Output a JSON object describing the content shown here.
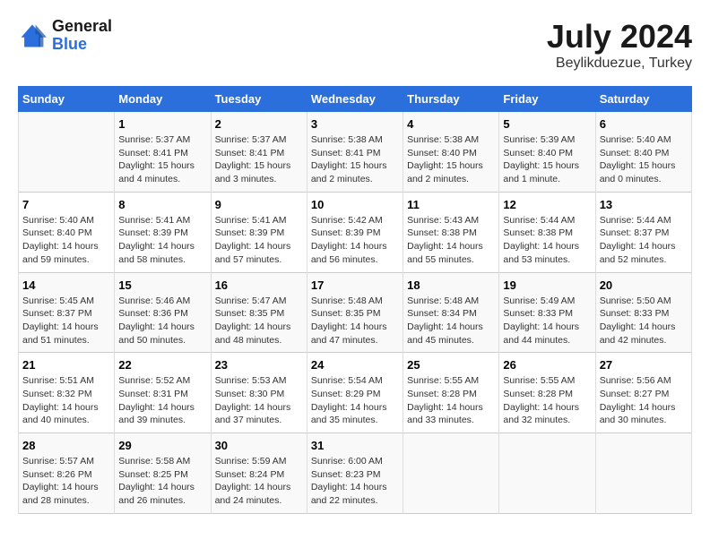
{
  "header": {
    "logo_general": "General",
    "logo_blue": "Blue",
    "month_year": "July 2024",
    "location": "Beylikduezue, Turkey"
  },
  "weekdays": [
    "Sunday",
    "Monday",
    "Tuesday",
    "Wednesday",
    "Thursday",
    "Friday",
    "Saturday"
  ],
  "weeks": [
    [
      {
        "day": "",
        "info": ""
      },
      {
        "day": "1",
        "info": "Sunrise: 5:37 AM\nSunset: 8:41 PM\nDaylight: 15 hours\nand 4 minutes."
      },
      {
        "day": "2",
        "info": "Sunrise: 5:37 AM\nSunset: 8:41 PM\nDaylight: 15 hours\nand 3 minutes."
      },
      {
        "day": "3",
        "info": "Sunrise: 5:38 AM\nSunset: 8:41 PM\nDaylight: 15 hours\nand 2 minutes."
      },
      {
        "day": "4",
        "info": "Sunrise: 5:38 AM\nSunset: 8:40 PM\nDaylight: 15 hours\nand 2 minutes."
      },
      {
        "day": "5",
        "info": "Sunrise: 5:39 AM\nSunset: 8:40 PM\nDaylight: 15 hours\nand 1 minute."
      },
      {
        "day": "6",
        "info": "Sunrise: 5:40 AM\nSunset: 8:40 PM\nDaylight: 15 hours\nand 0 minutes."
      }
    ],
    [
      {
        "day": "7",
        "info": "Sunrise: 5:40 AM\nSunset: 8:40 PM\nDaylight: 14 hours\nand 59 minutes."
      },
      {
        "day": "8",
        "info": "Sunrise: 5:41 AM\nSunset: 8:39 PM\nDaylight: 14 hours\nand 58 minutes."
      },
      {
        "day": "9",
        "info": "Sunrise: 5:41 AM\nSunset: 8:39 PM\nDaylight: 14 hours\nand 57 minutes."
      },
      {
        "day": "10",
        "info": "Sunrise: 5:42 AM\nSunset: 8:39 PM\nDaylight: 14 hours\nand 56 minutes."
      },
      {
        "day": "11",
        "info": "Sunrise: 5:43 AM\nSunset: 8:38 PM\nDaylight: 14 hours\nand 55 minutes."
      },
      {
        "day": "12",
        "info": "Sunrise: 5:44 AM\nSunset: 8:38 PM\nDaylight: 14 hours\nand 53 minutes."
      },
      {
        "day": "13",
        "info": "Sunrise: 5:44 AM\nSunset: 8:37 PM\nDaylight: 14 hours\nand 52 minutes."
      }
    ],
    [
      {
        "day": "14",
        "info": "Sunrise: 5:45 AM\nSunset: 8:37 PM\nDaylight: 14 hours\nand 51 minutes."
      },
      {
        "day": "15",
        "info": "Sunrise: 5:46 AM\nSunset: 8:36 PM\nDaylight: 14 hours\nand 50 minutes."
      },
      {
        "day": "16",
        "info": "Sunrise: 5:47 AM\nSunset: 8:35 PM\nDaylight: 14 hours\nand 48 minutes."
      },
      {
        "day": "17",
        "info": "Sunrise: 5:48 AM\nSunset: 8:35 PM\nDaylight: 14 hours\nand 47 minutes."
      },
      {
        "day": "18",
        "info": "Sunrise: 5:48 AM\nSunset: 8:34 PM\nDaylight: 14 hours\nand 45 minutes."
      },
      {
        "day": "19",
        "info": "Sunrise: 5:49 AM\nSunset: 8:33 PM\nDaylight: 14 hours\nand 44 minutes."
      },
      {
        "day": "20",
        "info": "Sunrise: 5:50 AM\nSunset: 8:33 PM\nDaylight: 14 hours\nand 42 minutes."
      }
    ],
    [
      {
        "day": "21",
        "info": "Sunrise: 5:51 AM\nSunset: 8:32 PM\nDaylight: 14 hours\nand 40 minutes."
      },
      {
        "day": "22",
        "info": "Sunrise: 5:52 AM\nSunset: 8:31 PM\nDaylight: 14 hours\nand 39 minutes."
      },
      {
        "day": "23",
        "info": "Sunrise: 5:53 AM\nSunset: 8:30 PM\nDaylight: 14 hours\nand 37 minutes."
      },
      {
        "day": "24",
        "info": "Sunrise: 5:54 AM\nSunset: 8:29 PM\nDaylight: 14 hours\nand 35 minutes."
      },
      {
        "day": "25",
        "info": "Sunrise: 5:55 AM\nSunset: 8:28 PM\nDaylight: 14 hours\nand 33 minutes."
      },
      {
        "day": "26",
        "info": "Sunrise: 5:55 AM\nSunset: 8:28 PM\nDaylight: 14 hours\nand 32 minutes."
      },
      {
        "day": "27",
        "info": "Sunrise: 5:56 AM\nSunset: 8:27 PM\nDaylight: 14 hours\nand 30 minutes."
      }
    ],
    [
      {
        "day": "28",
        "info": "Sunrise: 5:57 AM\nSunset: 8:26 PM\nDaylight: 14 hours\nand 28 minutes."
      },
      {
        "day": "29",
        "info": "Sunrise: 5:58 AM\nSunset: 8:25 PM\nDaylight: 14 hours\nand 26 minutes."
      },
      {
        "day": "30",
        "info": "Sunrise: 5:59 AM\nSunset: 8:24 PM\nDaylight: 14 hours\nand 24 minutes."
      },
      {
        "day": "31",
        "info": "Sunrise: 6:00 AM\nSunset: 8:23 PM\nDaylight: 14 hours\nand 22 minutes."
      },
      {
        "day": "",
        "info": ""
      },
      {
        "day": "",
        "info": ""
      },
      {
        "day": "",
        "info": ""
      }
    ]
  ]
}
